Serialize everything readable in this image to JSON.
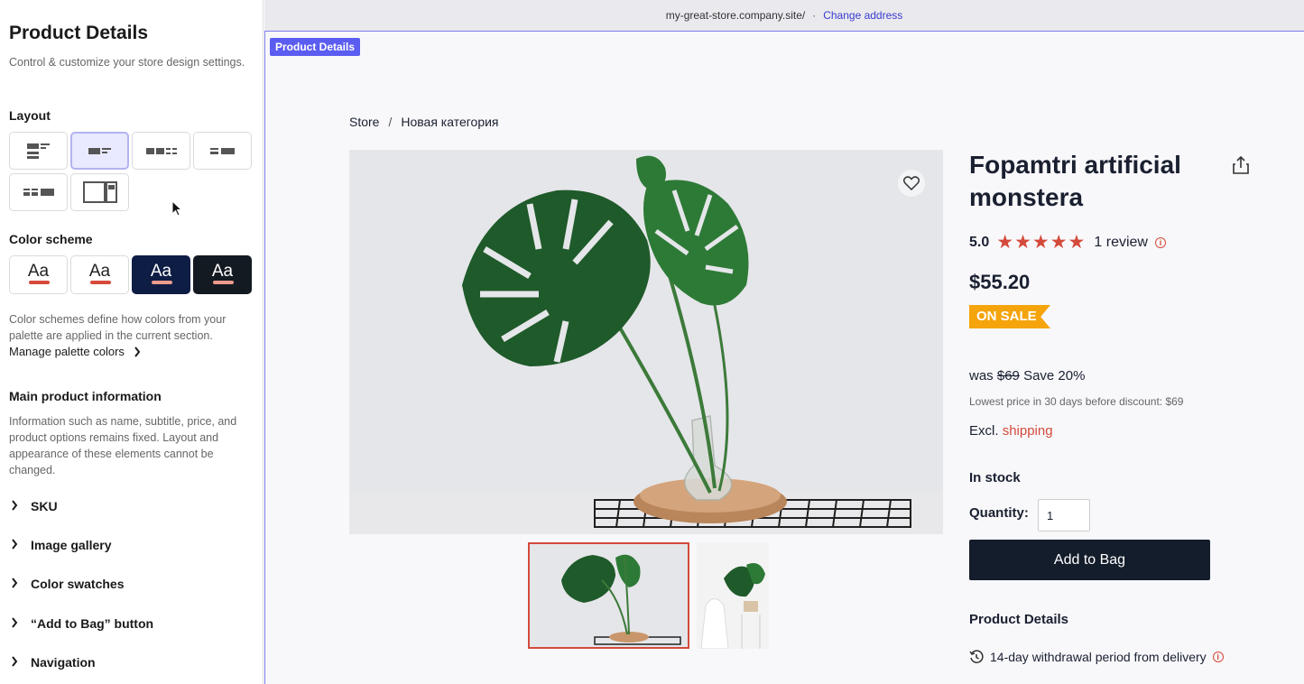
{
  "sidebar": {
    "title": "Product Details",
    "subtitle": "Control & customize your store design settings.",
    "layout_heading": "Layout",
    "color_scheme_heading": "Color scheme",
    "scheme_sample": "Aa",
    "color_scheme_desc": "Color schemes define how colors from your palette are applied in the current section.",
    "manage_palette": "Manage palette colors",
    "main_info_heading": "Main product information",
    "main_info_desc": "Information such as name, subtitle, price, and product options remains fixed. Layout and appearance of these elements cannot be changed.",
    "items": [
      {
        "label": "SKU"
      },
      {
        "label": "Image gallery"
      },
      {
        "label": "Color swatches"
      },
      {
        "label": "“Add to Bag” button"
      },
      {
        "label": "Navigation"
      }
    ],
    "selected_layout": 2,
    "selected_scheme": 1
  },
  "preview": {
    "address": "my-great-store.company.site/",
    "separator": "·",
    "change_address": "Change address",
    "section_badge": "Product Details",
    "breadcrumb": [
      "Store",
      "/",
      "Новая категория"
    ],
    "product": {
      "title": "Fopamtri artificial monstera",
      "rating": "5.0",
      "rating_value": 5,
      "stars": "★★★★★",
      "reviews": "1 review",
      "price": "$55.20",
      "sale_badge": "ON SALE",
      "was_label": "was",
      "was_price": "$69",
      "save": "Save 20%",
      "lowest_price": "Lowest price in 30 days before discount: $69",
      "excl_label": "Excl.",
      "shipping": "shipping",
      "stock": "In stock",
      "quantity_label": "Quantity:",
      "quantity_value": "1",
      "add_to_bag": "Add to Bag",
      "details_heading": "Product Details",
      "withdrawal": "14-day withdrawal period from delivery"
    }
  },
  "colors": {
    "accent": "#5b5cf0",
    "sale": "#f5a40b",
    "stars": "#d44a3a",
    "button": "#141d2b"
  }
}
